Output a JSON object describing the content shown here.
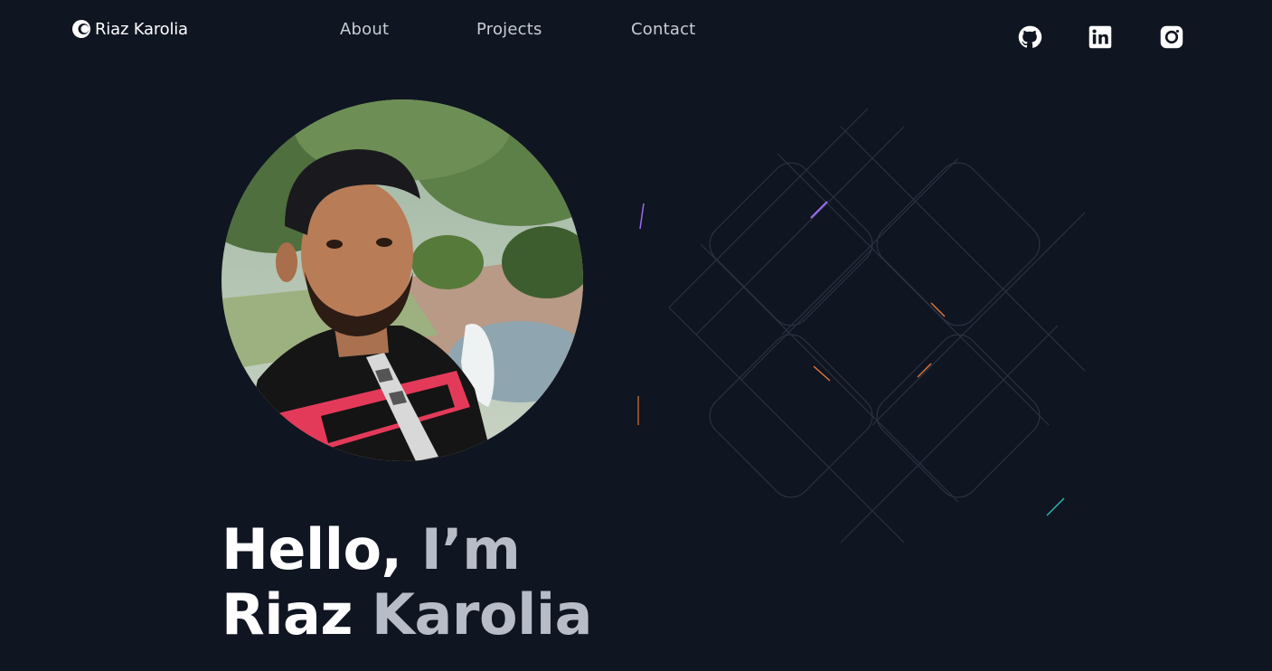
{
  "brand": {
    "name": "Riaz Karolia",
    "logo_icon": "circle-logo-icon"
  },
  "nav": {
    "items": [
      "About",
      "Projects",
      "Contact"
    ]
  },
  "socials": {
    "icons": [
      "github-icon",
      "linkedin-icon",
      "instagram-icon"
    ]
  },
  "hero": {
    "line1_a": "Hello, ",
    "line1_b": "I’m",
    "line2_a": "Riaz ",
    "line2_b": "Karolia"
  },
  "colors": {
    "background": "#0f1521",
    "text_primary": "#ffffff",
    "text_muted": "#b8bcc6",
    "nav_text": "#c9ccd3",
    "accent_orange": "#e0743a",
    "accent_purple": "#9b6cf0",
    "accent_teal": "#2bb8b0"
  }
}
